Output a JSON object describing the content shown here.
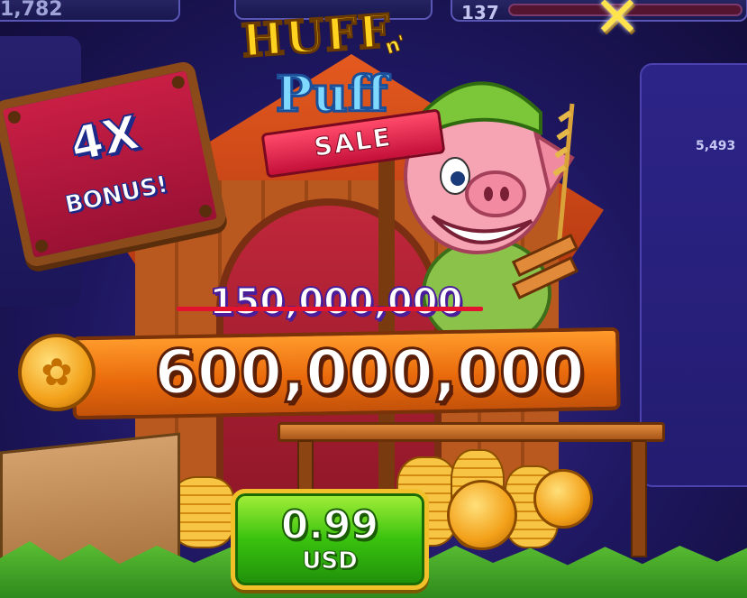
{
  "hud": {
    "coin_balance": "1,782",
    "level": "137"
  },
  "side_panel": {
    "value": "5,493"
  },
  "offer": {
    "logo_line1": "HUFF",
    "logo_and": "n'",
    "logo_line2": "Puff",
    "logo_ribbon": "SALE",
    "bonus_multiplier": "4X",
    "bonus_word": "BONUS!",
    "old_amount": "150,000,000",
    "new_amount": "600,000,000"
  },
  "buy_button": {
    "price": "0.99",
    "currency": "USD"
  },
  "icons": {
    "close": "close-x-icon",
    "coin": "gold-coin-icon"
  },
  "colors": {
    "accent_gold": "#ffd21f",
    "button_green": "#39c20e",
    "sign_red": "#c91e45",
    "plank_orange": "#e96a0c"
  }
}
